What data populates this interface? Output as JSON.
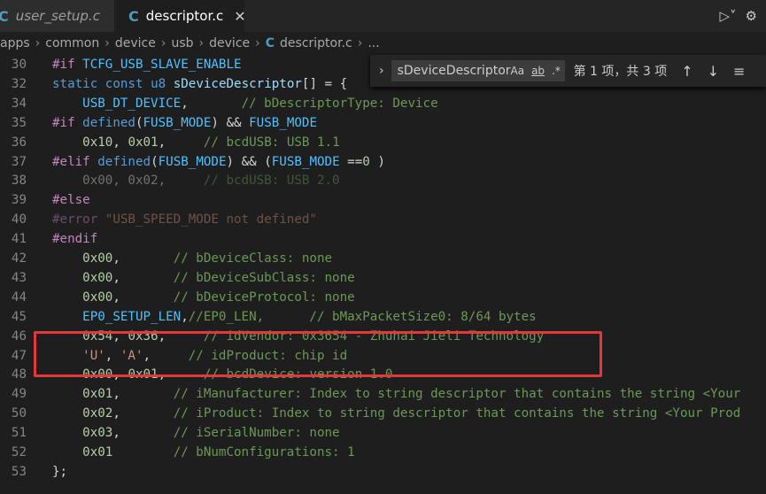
{
  "tabs": [
    {
      "icon": "C",
      "label": "user_setup.c"
    },
    {
      "icon": "C",
      "label": "descriptor.c",
      "close": "✕"
    }
  ],
  "breadcrumb": [
    "apps",
    "common",
    "device",
    "usb",
    "device",
    "descriptor.c",
    "..."
  ],
  "find": {
    "term": "sDeviceDescriptor",
    "opt_case": "Aa",
    "opt_word": "ab",
    "opt_regex": ".*",
    "count": "第 1 项，共 3 项"
  },
  "lines": [
    {
      "n": "30",
      "html": "<span class='kw'>#if</span> <span class='mac'>TCFG_USB_SLAVE_ENABLE</span>"
    },
    {
      "n": "32",
      "html": "<span class='kb'>static</span> <span class='kb'>const</span> <span class='kb'>u8</span> <span class='var'>sDeviceDescriptor</span><span class='pl'>[] = {</span>"
    },
    {
      "n": "34",
      "html": "    <span class='mac'>USB_DT_DEVICE</span><span class='pl'>,       </span><span class='cmt'>// bDescriptorType: Device</span>"
    },
    {
      "n": "35",
      "html": "<span class='kw'>#if</span> <span class='kb'>defined</span><span class='pl'>(</span><span class='mac'>FUSB_MODE</span><span class='pl'>) &amp;&amp; </span><span class='mac'>FUSB_MODE</span>"
    },
    {
      "n": "36",
      "html": "    <span class='num'>0x10</span><span class='pl'>, </span><span class='num'>0x01</span><span class='pl'>,     </span><span class='cmt'>// bcdUSB: USB 1.1</span>"
    },
    {
      "n": "37",
      "html": "<span class='kw'>#elif</span> <span class='kb'>defined</span><span class='pl'>(</span><span class='mac'>FUSB_MODE</span><span class='pl'>) &amp;&amp; (</span><span class='mac'>FUSB_MODE</span> <span class='pl'>==</span><span class='num'>0</span> <span class='pl'>)</span>"
    },
    {
      "n": "38",
      "html": "<span class='dim'><span class='pl'>    0x00, 0x02,     </span><span class='cmt'>// bcdUSB: USB 2.0</span></span>"
    },
    {
      "n": "39",
      "html": "<span class='kw'>#else</span>"
    },
    {
      "n": "40",
      "html": "<span class='dim'><span class='kw'>#error</span> <span class='str'>\"USB_SPEED_MODE not defined\"</span></span>"
    },
    {
      "n": "41",
      "html": "<span class='kw'>#endif</span>"
    },
    {
      "n": "42",
      "html": "    <span class='num'>0x00</span><span class='pl'>,       </span><span class='cmt'>// bDeviceClass: none</span>"
    },
    {
      "n": "43",
      "html": "    <span class='num'>0x00</span><span class='pl'>,       </span><span class='cmt'>// bDeviceSubClass: none</span>"
    },
    {
      "n": "44",
      "html": "    <span class='num'>0x00</span><span class='pl'>,       </span><span class='cmt'>// bDeviceProtocol: none</span>"
    },
    {
      "n": "45",
      "html": "    <span class='mac'>EP0_SETUP_LEN</span><span class='pl'>,</span><span class='cmt'>//EP0_LEN,      // bMaxPacketSize0: 8/64 bytes</span>"
    },
    {
      "n": "46",
      "html": "    <span class='num'>0x54</span><span class='pl'>, </span><span class='num'>0x36</span><span class='pl'>,     </span><span class='cmt'>// idVendor: 0x3654 - Zhuhai Jieli Technology</span>"
    },
    {
      "n": "47",
      "html": "    <span class='str'>'U'</span><span class='pl'>, </span><span class='str'>'A'</span><span class='pl'>,     </span><span class='cmt'>// idProduct: chip id</span>"
    },
    {
      "n": "48",
      "html": "    <span class='num'>0x00</span><span class='pl'>, </span><span class='num'>0x01</span><span class='pl'>,     </span><span class='cmt'>// bcdDevice: version 1.0</span>"
    },
    {
      "n": "49",
      "html": "    <span class='num'>0x01</span><span class='pl'>,       </span><span class='cmt'>// iManufacturer: Index to string descriptor that contains the string &lt;Your</span>"
    },
    {
      "n": "50",
      "html": "    <span class='num'>0x02</span><span class='pl'>,       </span><span class='cmt'>// iProduct: Index to string descriptor that contains the string &lt;Your Prod</span>"
    },
    {
      "n": "51",
      "html": "    <span class='num'>0x03</span><span class='pl'>,       </span><span class='cmt'>// iSerialNumber: none</span>"
    },
    {
      "n": "52",
      "html": "    <span class='num'>0x01</span>        <span class='cmt'>// bNumConfigurations: 1</span>"
    },
    {
      "n": "53",
      "html": "<span class='pl'>};</span>"
    }
  ]
}
